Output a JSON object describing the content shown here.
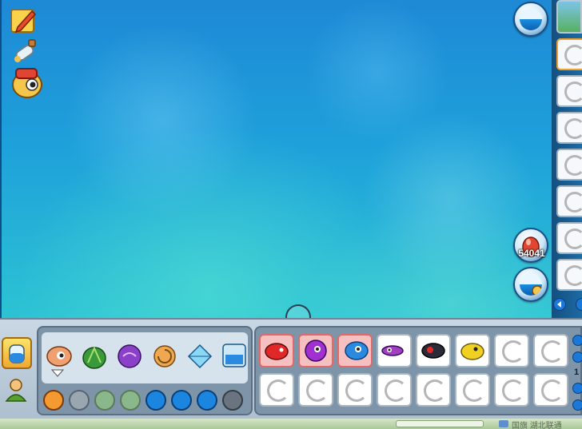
{
  "aquarium": {
    "tools": [
      {
        "name": "edit-pencil-icon"
      },
      {
        "name": "potion-bottle-icon"
      },
      {
        "name": "fish-mascot-icon"
      }
    ],
    "count_value": "54041"
  },
  "right_panel": {
    "slots": 7
  },
  "bottom": {
    "categories": [
      "clownfish-icon",
      "seaweed-icon",
      "purple-orb-icon",
      "nautilus-shell-icon",
      "crystal-icon",
      "scenery-icon"
    ],
    "subcategories": [
      "orange-swirl-icon",
      "gray-ring-icon",
      "green-arrow-icon",
      "green-w-icon",
      "blue-up-icon",
      "blue-down-icon",
      "blue-cross-icon",
      "gray-dark-icon"
    ],
    "fish_row": [
      {
        "name": "red-piranha-icon",
        "pink": true
      },
      {
        "name": "purple-puffer-icon",
        "pink": true
      },
      {
        "name": "blue-fish-icon",
        "pink": true
      },
      {
        "name": "purple-eel-icon",
        "pink": false
      },
      {
        "name": "black-red-fish-icon",
        "pink": false
      },
      {
        "name": "yellow-piranha-icon",
        "pink": false
      },
      {
        "name": "loading-icon",
        "pink": false
      },
      {
        "name": "loading-icon",
        "pink": false
      }
    ],
    "page_number": "1"
  },
  "status": {
    "text": "国旗 湖北联通"
  },
  "colors": {
    "accent": "#1a78d8",
    "selected_tab": "#f0a830"
  }
}
